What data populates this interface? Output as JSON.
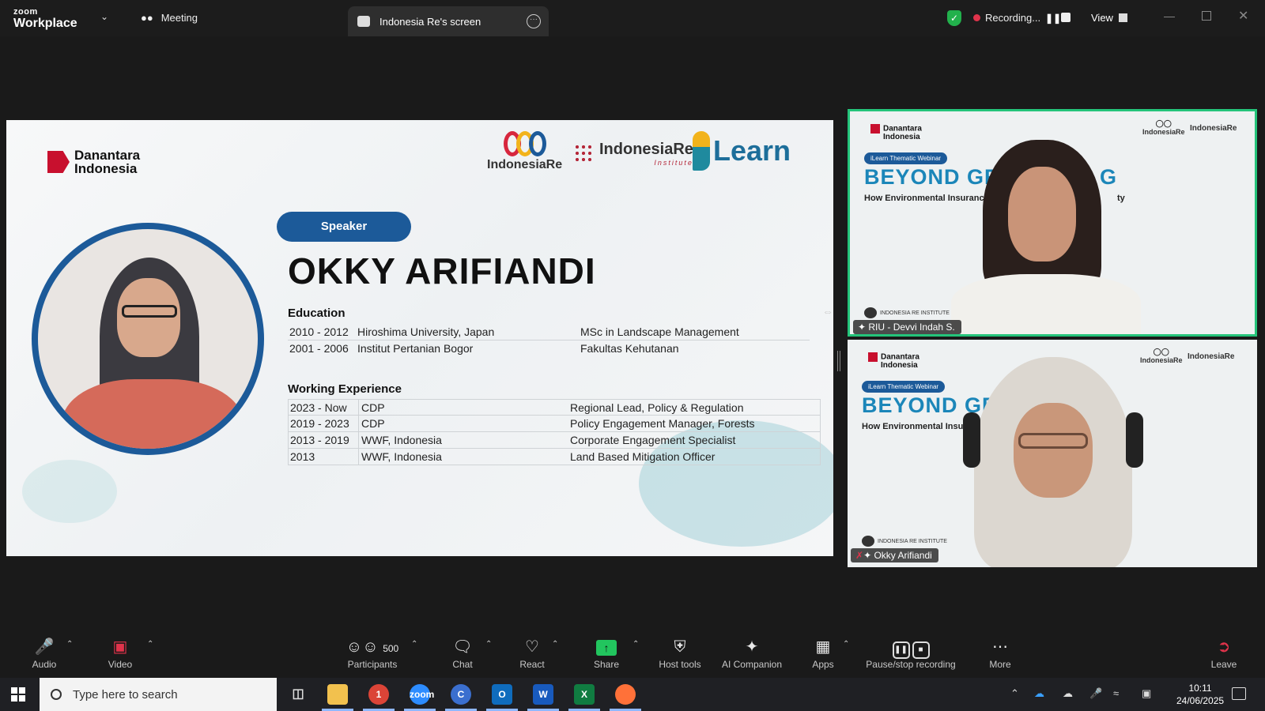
{
  "app": {
    "brand_small": "zoom",
    "brand_large": "Workplace"
  },
  "tabs": {
    "meeting": "Meeting",
    "screen": "Indonesia Re's screen"
  },
  "recording": {
    "label": "Recording...",
    "view": "View"
  },
  "slide": {
    "logo_danantara_1": "Danantara",
    "logo_danantara_2": "Indonesia",
    "logo_ire": "IndonesiaRe",
    "logo_iri": "IndonesiaRe",
    "logo_iri_sub": "Institute",
    "logo_learn": "Learn",
    "speaker_pill": "Speaker",
    "speaker_name": "OKKY ARIFIANDI",
    "education_heading": "Education",
    "education": [
      {
        "years": "2010 - 2012",
        "place": "Hiroshima University, Japan",
        "degree": "MSc in Landscape Management"
      },
      {
        "years": "2001 - 2006",
        "place": "Institut Pertanian Bogor",
        "degree": "Fakultas Kehutanan"
      }
    ],
    "work_heading": "Working Experience",
    "work": [
      {
        "years": "2023 - Now",
        "org": "CDP",
        "role": "Regional Lead, Policy & Regulation"
      },
      {
        "years": "2019 - 2023",
        "org": "CDP",
        "role": "Policy Engagement Manager, Forests"
      },
      {
        "years": "2013 - 2019",
        "org": "WWF, Indonesia",
        "role": "Corporate Engagement Specialist"
      },
      {
        "years": "2013",
        "org": "WWF, Indonesia",
        "role": "Land Based Mitigation Officer"
      }
    ]
  },
  "participants": [
    {
      "name": "RIU - Devvi Indah S.",
      "title": "BEYOND GREE",
      "title_tail": "G",
      "subtitle": "How Environmental Insurance",
      "subtitle_tail": "ty",
      "tag": "iLearn Thematic Webinar",
      "footer": "INDONESIA RE INSTITUTE",
      "logo_1": "Danantara",
      "logo_2": "Indonesia",
      "logo_re": "IndonesiaRe",
      "logo_iri": "IndonesiaRe"
    },
    {
      "name": "Okky Arifiandi",
      "title": "BEYOND GREE",
      "subtitle": "How Environmental Insurance",
      "tag": "iLearn Thematic Webinar",
      "footer": "INDONESIA RE INSTITUTE",
      "logo_1": "Danantara",
      "logo_2": "Indonesia",
      "logo_re": "IndonesiaRe",
      "logo_iri": "IndonesiaRe"
    }
  ],
  "toolbar": {
    "audio": "Audio",
    "video": "Video",
    "participants": "Participants",
    "participants_count": "500",
    "chat": "Chat",
    "react": "React",
    "share": "Share",
    "host_tools": "Host tools",
    "ai_companion": "AI Companion",
    "apps": "Apps",
    "pause_stop": "Pause/stop recording",
    "more": "More",
    "leave": "Leave"
  },
  "taskbar": {
    "search_placeholder": "Type here to search",
    "time": "10:11",
    "date": "24/06/2025",
    "chrome_badge": "1"
  },
  "colors": {
    "accent_blue": "#1c5a99",
    "active_speaker": "#24c47a",
    "recording": "#e0334b",
    "share": "#22c55e"
  },
  "icons": [
    "shield-icon",
    "record-icon",
    "pause-icon",
    "stop-icon",
    "mic-muted-icon",
    "video-off-icon",
    "participants-icon",
    "chat-icon",
    "heart-icon",
    "share-arrow-icon",
    "host-shield-icon",
    "sparkle-icon",
    "apps-icon",
    "more-icon",
    "leave-icon"
  ]
}
